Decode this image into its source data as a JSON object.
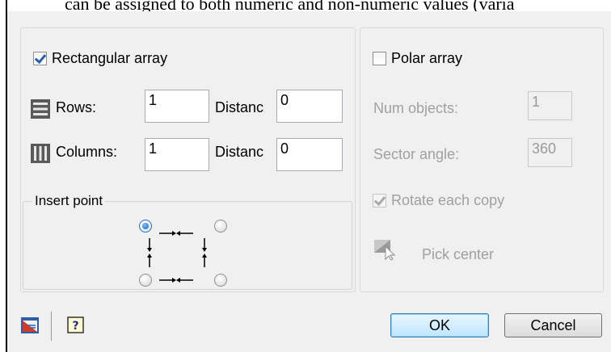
{
  "document": {
    "text_fragment": "can be assigned to both numeric and non-numeric values (varia"
  },
  "rectangular": {
    "label": "Rectangular array",
    "checked": true,
    "rows_label": "Rows:",
    "rows_value": "1",
    "row_distance_label": "Distanc",
    "row_distance_value": "0",
    "columns_label": "Columns:",
    "columns_value": "1",
    "column_distance_label": "Distanc",
    "column_distance_value": "0",
    "insert_point_label": "Insert point",
    "insert_point_selected": "top-left"
  },
  "polar": {
    "label": "Polar array",
    "checked": false,
    "num_objects_label": "Num objects:",
    "num_objects_value": "1",
    "sector_angle_label": "Sector angle:",
    "sector_angle_value": "360",
    "rotate_label": "Rotate each copy",
    "rotate_checked": true,
    "pick_center_label": "Pick center"
  },
  "buttons": {
    "ok": "OK",
    "cancel": "Cancel"
  },
  "icons": {
    "rows": "rows-icon",
    "columns": "columns-icon",
    "pick_center": "pick-center-icon",
    "preview": "preview-icon",
    "help": "help-icon"
  }
}
